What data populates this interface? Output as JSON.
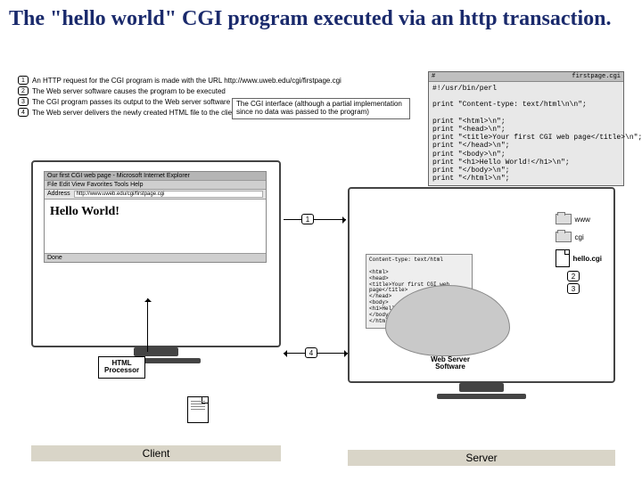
{
  "title": "The \"hello world\" CGI program executed via an http transaction.",
  "steps": [
    "An HTTP request for the CGI program is made with the URL http://www.uweb.edu/cgi/firstpage.cgi",
    "The Web server software causes the program to be executed",
    "The CGI program passes its output to the Web server software",
    "The Web server delivers the newly created HTML file to the client, completing the HTTP transaction"
  ],
  "cgi_note": "The CGI interface (although a partial implementation since no data was passed to the program)",
  "code_window": {
    "filename": "firstpage.cgi",
    "shebang": "#!/usr/bin/perl",
    "lines": [
      "print \"Content-type: text/html\\n\\n\";",
      "",
      "print \"<html>\\n\";",
      "print \"<head>\\n\";",
      "print \"<title>Your first CGI web page</title>\\n\";",
      "print \"</head>\\n\";",
      "print \"<body>\\n\";",
      "print \"<h1>Hello World!</h1>\\n\";",
      "print \"</body>\\n\";",
      "print \"</html>\\n\";"
    ]
  },
  "browser": {
    "title": "Our first CGI web page - Microsoft Internet Explorer",
    "menu": "File  Edit  View  Favorites  Tools  Help",
    "address_label": "Address",
    "url": "http://www.uweb.edu/cgi/firstpage.cgi",
    "heading": "Hello World!",
    "status": "Done"
  },
  "html_processor": "HTML\nProcessor",
  "captions": {
    "client": "Client",
    "server": "Server"
  },
  "http_output": {
    "header": "Content-type: text/html",
    "body": [
      "<html>",
      "<head>",
      "<title>Your first CGI web page</title>",
      "</head>",
      "<body>",
      "<h1>Hello World!</h1>",
      "</body>",
      "</html>"
    ]
  },
  "web_server_label": "Web Server\nSoftware",
  "files": {
    "www": "www",
    "cgi": "cgi",
    "hello": "hello.cgi"
  },
  "flow_numbers": {
    "n1": "1",
    "n2": "2",
    "n3": "3",
    "n4": "4"
  }
}
